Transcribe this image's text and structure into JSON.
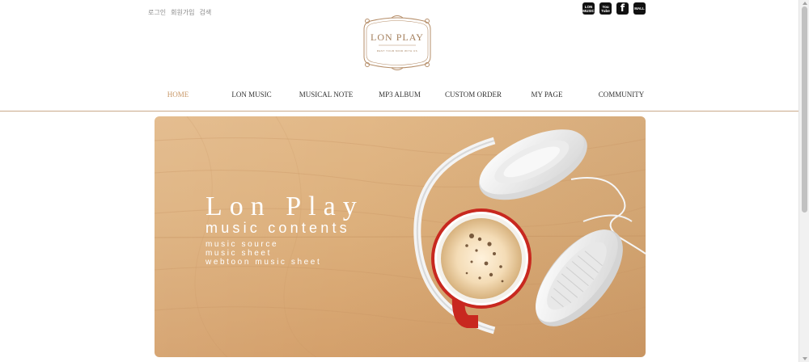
{
  "util_links": [
    "로그인",
    "회원가입",
    "검색"
  ],
  "socials": [
    {
      "icon": "lon-music-icon",
      "label": "LON MUSIC"
    },
    {
      "icon": "youtube-icon",
      "label": "You Tube"
    },
    {
      "icon": "facebook-icon",
      "label": "f"
    },
    {
      "icon": "mall-icon",
      "label": "MALL"
    }
  ],
  "logo": {
    "title": "LON PLAY",
    "tagline": "REST YOUR MIND WITH US"
  },
  "nav": {
    "items": [
      "HOME",
      "LON MUSIC",
      "MUSICAL NOTE",
      "MP3 ALBUM",
      "CUSTOM ORDER",
      "MY PAGE",
      "COMMUNITY"
    ],
    "active": "HOME"
  },
  "hero": {
    "title": "Lon Play",
    "subtitle": "music contents",
    "lines": [
      "music source",
      "music sheet",
      "webtoon music sheet"
    ]
  },
  "colors": {
    "accent": "#c89766",
    "logo": "#a47f5c",
    "rule": "#c9a98a",
    "wood": "#ddb07c"
  }
}
